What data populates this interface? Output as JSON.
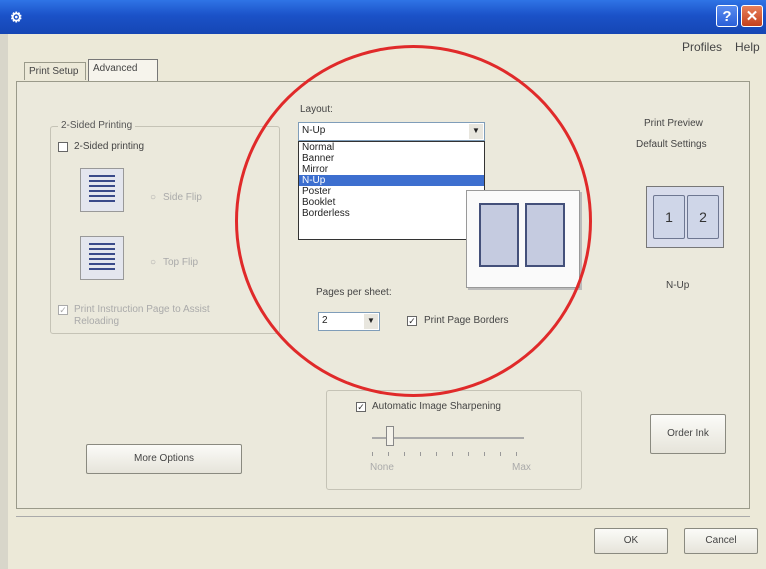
{
  "window": {
    "help_label": "?",
    "close_label": "✕",
    "app_icon": "printer-properties-icon"
  },
  "menu": {
    "profiles": "Profiles",
    "help": "Help"
  },
  "tabs": [
    "Print Setup",
    "Advanced"
  ],
  "two_sided": {
    "legend": "2-Sided Printing",
    "checkbox_label": "2-Sided printing",
    "side_flip": "Side Flip",
    "top_flip": "Top Flip",
    "instruction": "Print Instruction Page to Assist Reloading"
  },
  "layout": {
    "label": "Layout:",
    "selected": "N-Up",
    "options": [
      "Normal",
      "Banner",
      "Mirror",
      "N-Up",
      "Poster",
      "Booklet",
      "Borderless"
    ],
    "pages_per_sheet_label": "Pages per sheet:",
    "pages_per_sheet_value": "2",
    "print_page_borders": "Print Page Borders"
  },
  "preview": {
    "title": "Print Preview",
    "subtitle": "Default Settings",
    "page1": "1",
    "page2": "2",
    "mode": "N-Up"
  },
  "sharpening": {
    "label": "Automatic Image Sharpening",
    "min_label": "None",
    "max_label": "Max"
  },
  "buttons": {
    "more_options": "More Options",
    "order_ink": "Order Ink",
    "ok": "OK",
    "cancel": "Cancel"
  },
  "colors": {
    "annotation_circle": "#e02a2a",
    "titlebar": "#1b52c8",
    "selection": "#3d6fcf"
  }
}
